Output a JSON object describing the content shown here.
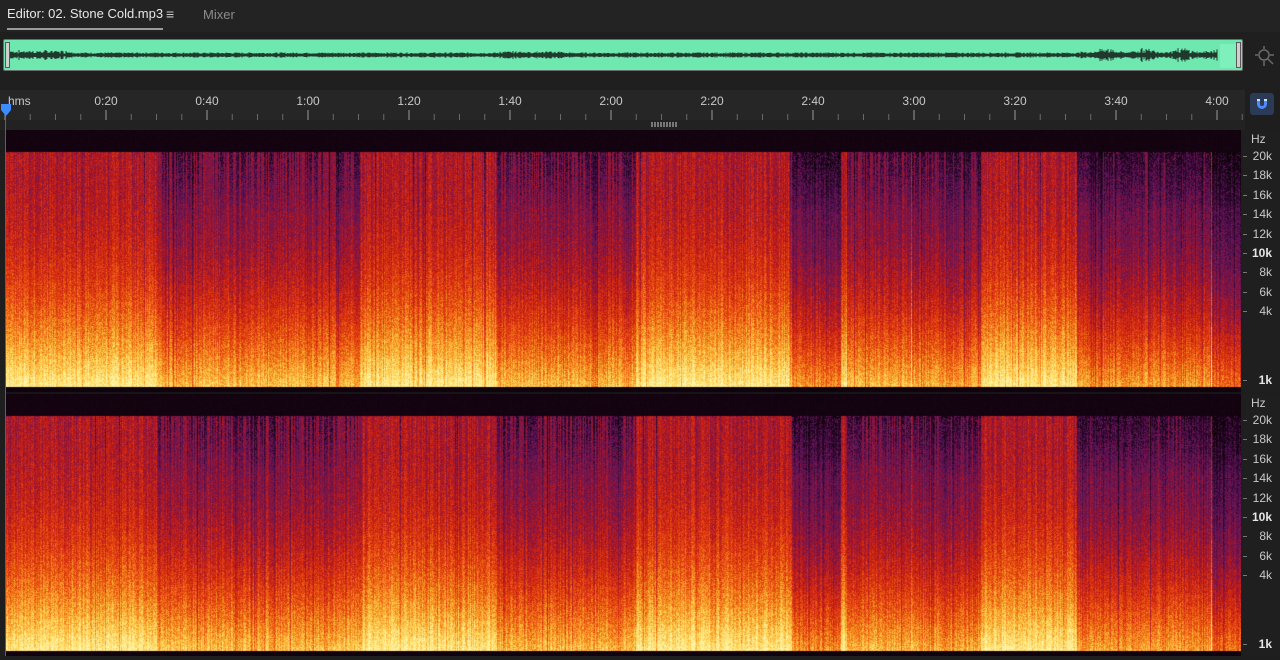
{
  "tabs": {
    "editor": "Editor: 02. Stone Cold.mp3",
    "mixer": "Mixer",
    "menu_glyph": "≡"
  },
  "colors": {
    "overview_waveform_bg": "#6fe8b0",
    "playhead": "#3d6fd8",
    "spectrum_low": "#0a0205",
    "spectrum_mid": "#d42a12",
    "spectrum_high": "#fff3a0"
  },
  "ruler": {
    "unit": "hms",
    "labels": [
      "0:20",
      "0:40",
      "1:00",
      "1:20",
      "1:40",
      "2:00",
      "2:20",
      "2:40",
      "3:00",
      "3:20",
      "3:40",
      "4:00"
    ]
  },
  "frequency_scale": {
    "unit": "Hz",
    "labels": [
      "20k",
      "18k",
      "16k",
      "14k",
      "12k",
      "10k",
      "8k",
      "6k",
      "4k",
      "1k"
    ]
  },
  "icons": {
    "zoom": "zoom-magnifier-icon",
    "snap": "magnet-snap-icon",
    "menu": "hamburger-menu-icon",
    "playhead": "playhead-marker-icon"
  }
}
